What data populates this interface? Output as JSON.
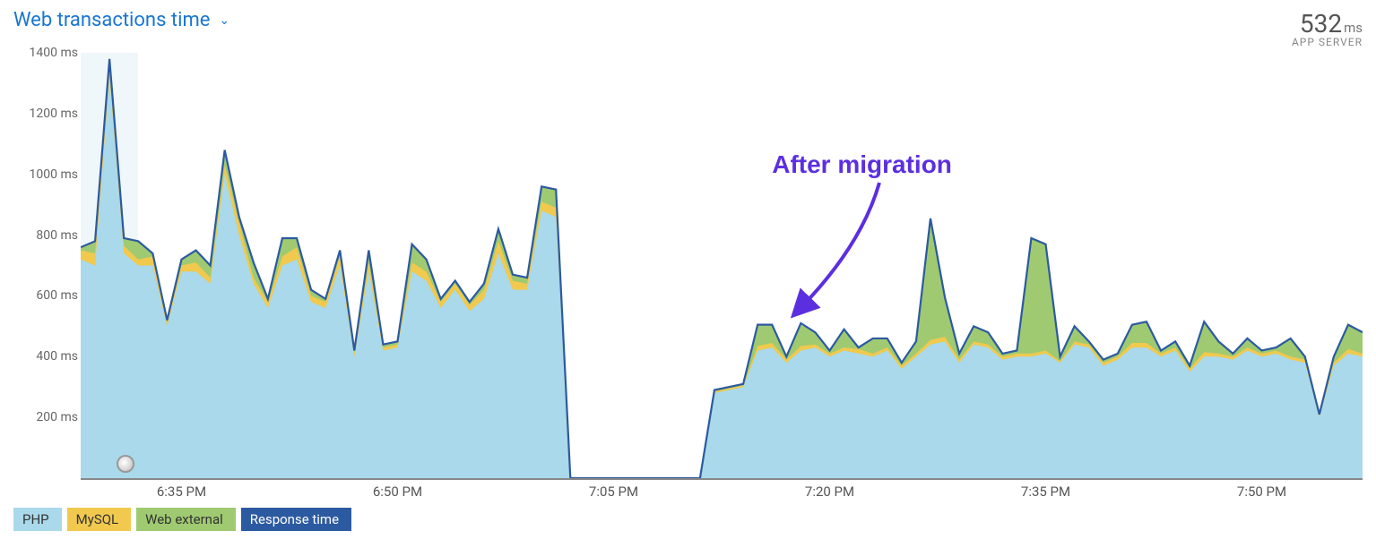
{
  "header": {
    "title": "Web transactions time",
    "metric_value": "532",
    "metric_unit": "ms",
    "metric_label": "APP SERVER"
  },
  "legend": {
    "php": "PHP",
    "mysql": "MySQL",
    "web_external": "Web external",
    "response_time": "Response time"
  },
  "annotation": {
    "label": "After migration"
  },
  "chart_data": {
    "type": "area",
    "title": "Web transactions time",
    "xlabel": "",
    "ylabel": "ms",
    "ylim": [
      0,
      1400
    ],
    "x_ticks": [
      "6:35 PM",
      "6:50 PM",
      "7:05 PM",
      "7:20 PM",
      "7:35 PM",
      "7:50 PM"
    ],
    "y_ticks": [
      200,
      400,
      600,
      800,
      1000,
      1200,
      1400
    ],
    "series": [
      {
        "name": "PHP",
        "color": "#a9d9ea",
        "role": "stack-bottom"
      },
      {
        "name": "MySQL",
        "color": "#f0c94e",
        "role": "stack-mid"
      },
      {
        "name": "Web external",
        "color": "#9fca71",
        "role": "stack-top"
      },
      {
        "name": "Response time",
        "color": "#2c5aa0",
        "role": "line"
      }
    ],
    "x_minutes_start": 388,
    "x_minutes_end": 477,
    "points": [
      {
        "t": 388,
        "php": 720,
        "mysql": 30,
        "web": 10,
        "rt": 760
      },
      {
        "t": 389,
        "php": 700,
        "mysql": 40,
        "web": 40,
        "rt": 780
      },
      {
        "t": 390,
        "php": 1320,
        "mysql": 30,
        "web": 30,
        "rt": 1380
      },
      {
        "t": 391,
        "php": 740,
        "mysql": 25,
        "web": 25,
        "rt": 790
      },
      {
        "t": 392,
        "php": 700,
        "mysql": 20,
        "web": 60,
        "rt": 780
      },
      {
        "t": 393,
        "php": 700,
        "mysql": 30,
        "web": 10,
        "rt": 740
      },
      {
        "t": 394,
        "php": 500,
        "mysql": 10,
        "web": 10,
        "rt": 520
      },
      {
        "t": 395,
        "php": 680,
        "mysql": 20,
        "web": 20,
        "rt": 720
      },
      {
        "t": 396,
        "php": 680,
        "mysql": 30,
        "web": 40,
        "rt": 750
      },
      {
        "t": 397,
        "php": 640,
        "mysql": 20,
        "web": 40,
        "rt": 700
      },
      {
        "t": 398,
        "php": 1000,
        "mysql": 30,
        "web": 50,
        "rt": 1080
      },
      {
        "t": 399,
        "php": 800,
        "mysql": 40,
        "web": 20,
        "rt": 860
      },
      {
        "t": 400,
        "php": 640,
        "mysql": 20,
        "web": 50,
        "rt": 710
      },
      {
        "t": 401,
        "php": 560,
        "mysql": 20,
        "web": 10,
        "rt": 590
      },
      {
        "t": 402,
        "php": 700,
        "mysql": 30,
        "web": 60,
        "rt": 790
      },
      {
        "t": 403,
        "php": 720,
        "mysql": 40,
        "web": 30,
        "rt": 790
      },
      {
        "t": 404,
        "php": 580,
        "mysql": 20,
        "web": 20,
        "rt": 620
      },
      {
        "t": 405,
        "php": 560,
        "mysql": 20,
        "web": 10,
        "rt": 590
      },
      {
        "t": 406,
        "php": 700,
        "mysql": 30,
        "web": 20,
        "rt": 750
      },
      {
        "t": 407,
        "php": 400,
        "mysql": 10,
        "web": 10,
        "rt": 420
      },
      {
        "t": 408,
        "php": 680,
        "mysql": 30,
        "web": 40,
        "rt": 750
      },
      {
        "t": 409,
        "php": 420,
        "mysql": 10,
        "web": 10,
        "rt": 440
      },
      {
        "t": 410,
        "php": 430,
        "mysql": 10,
        "web": 10,
        "rt": 450
      },
      {
        "t": 411,
        "php": 680,
        "mysql": 30,
        "web": 60,
        "rt": 770
      },
      {
        "t": 412,
        "php": 650,
        "mysql": 30,
        "web": 40,
        "rt": 720
      },
      {
        "t": 413,
        "php": 560,
        "mysql": 20,
        "web": 10,
        "rt": 590
      },
      {
        "t": 414,
        "php": 620,
        "mysql": 20,
        "web": 10,
        "rt": 650
      },
      {
        "t": 415,
        "php": 550,
        "mysql": 20,
        "web": 10,
        "rt": 580
      },
      {
        "t": 416,
        "php": 590,
        "mysql": 30,
        "web": 20,
        "rt": 640
      },
      {
        "t": 417,
        "php": 740,
        "mysql": 40,
        "web": 40,
        "rt": 820
      },
      {
        "t": 418,
        "php": 620,
        "mysql": 30,
        "web": 20,
        "rt": 670
      },
      {
        "t": 419,
        "php": 620,
        "mysql": 20,
        "web": 20,
        "rt": 660
      },
      {
        "t": 420,
        "php": 880,
        "mysql": 30,
        "web": 50,
        "rt": 960
      },
      {
        "t": 421,
        "php": 860,
        "mysql": 30,
        "web": 60,
        "rt": 950
      },
      {
        "t": 422,
        "php": 0,
        "mysql": 0,
        "web": 0,
        "rt": 0
      },
      {
        "t": 431,
        "php": 0,
        "mysql": 0,
        "web": 0,
        "rt": 0
      },
      {
        "t": 432,
        "php": 280,
        "mysql": 5,
        "web": 5,
        "rt": 290
      },
      {
        "t": 434,
        "php": 300,
        "mysql": 5,
        "web": 5,
        "rt": 310
      },
      {
        "t": 435,
        "php": 420,
        "mysql": 15,
        "web": 70,
        "rt": 505
      },
      {
        "t": 436,
        "php": 430,
        "mysql": 15,
        "web": 60,
        "rt": 505
      },
      {
        "t": 437,
        "php": 380,
        "mysql": 10,
        "web": 10,
        "rt": 400
      },
      {
        "t": 438,
        "php": 420,
        "mysql": 15,
        "web": 70,
        "rt": 510
      },
      {
        "t": 439,
        "php": 430,
        "mysql": 10,
        "web": 40,
        "rt": 480
      },
      {
        "t": 440,
        "php": 400,
        "mysql": 10,
        "web": 10,
        "rt": 420
      },
      {
        "t": 441,
        "php": 420,
        "mysql": 10,
        "web": 60,
        "rt": 490
      },
      {
        "t": 442,
        "php": 410,
        "mysql": 15,
        "web": 5,
        "rt": 430
      },
      {
        "t": 443,
        "php": 400,
        "mysql": 10,
        "web": 50,
        "rt": 460
      },
      {
        "t": 444,
        "php": 420,
        "mysql": 10,
        "web": 30,
        "rt": 460
      },
      {
        "t": 445,
        "php": 360,
        "mysql": 10,
        "web": 10,
        "rt": 380
      },
      {
        "t": 446,
        "php": 400,
        "mysql": 10,
        "web": 40,
        "rt": 450
      },
      {
        "t": 447,
        "php": 440,
        "mysql": 15,
        "web": 400,
        "rt": 855
      },
      {
        "t": 448,
        "php": 450,
        "mysql": 15,
        "web": 130,
        "rt": 595
      },
      {
        "t": 449,
        "php": 380,
        "mysql": 10,
        "web": 20,
        "rt": 410
      },
      {
        "t": 450,
        "php": 440,
        "mysql": 10,
        "web": 50,
        "rt": 500
      },
      {
        "t": 451,
        "php": 430,
        "mysql": 10,
        "web": 40,
        "rt": 480
      },
      {
        "t": 452,
        "php": 390,
        "mysql": 10,
        "web": 10,
        "rt": 410
      },
      {
        "t": 453,
        "php": 400,
        "mysql": 10,
        "web": 10,
        "rt": 420
      },
      {
        "t": 454,
        "php": 400,
        "mysql": 10,
        "web": 380,
        "rt": 790
      },
      {
        "t": 455,
        "php": 410,
        "mysql": 10,
        "web": 350,
        "rt": 770
      },
      {
        "t": 456,
        "php": 380,
        "mysql": 5,
        "web": 15,
        "rt": 400
      },
      {
        "t": 457,
        "php": 440,
        "mysql": 10,
        "web": 50,
        "rt": 500
      },
      {
        "t": 458,
        "php": 430,
        "mysql": 10,
        "web": 10,
        "rt": 450
      },
      {
        "t": 459,
        "php": 370,
        "mysql": 10,
        "web": 10,
        "rt": 390
      },
      {
        "t": 460,
        "php": 390,
        "mysql": 10,
        "web": 10,
        "rt": 410
      },
      {
        "t": 461,
        "php": 430,
        "mysql": 15,
        "web": 60,
        "rt": 505
      },
      {
        "t": 462,
        "php": 430,
        "mysql": 15,
        "web": 70,
        "rt": 515
      },
      {
        "t": 463,
        "php": 400,
        "mysql": 10,
        "web": 10,
        "rt": 420
      },
      {
        "t": 464,
        "php": 420,
        "mysql": 10,
        "web": 20,
        "rt": 450
      },
      {
        "t": 465,
        "php": 350,
        "mysql": 10,
        "web": 10,
        "rt": 370
      },
      {
        "t": 466,
        "php": 400,
        "mysql": 15,
        "web": 100,
        "rt": 515
      },
      {
        "t": 467,
        "php": 400,
        "mysql": 10,
        "web": 40,
        "rt": 450
      },
      {
        "t": 468,
        "php": 390,
        "mysql": 10,
        "web": 10,
        "rt": 410
      },
      {
        "t": 469,
        "php": 420,
        "mysql": 10,
        "web": 30,
        "rt": 460
      },
      {
        "t": 470,
        "php": 400,
        "mysql": 10,
        "web": 10,
        "rt": 420
      },
      {
        "t": 471,
        "php": 410,
        "mysql": 10,
        "web": 10,
        "rt": 430
      },
      {
        "t": 472,
        "php": 390,
        "mysql": 10,
        "web": 60,
        "rt": 460
      },
      {
        "t": 473,
        "php": 380,
        "mysql": 10,
        "web": 10,
        "rt": 400
      },
      {
        "t": 474,
        "php": 200,
        "mysql": 5,
        "web": 5,
        "rt": 210
      },
      {
        "t": 475,
        "php": 370,
        "mysql": 10,
        "web": 20,
        "rt": 400
      },
      {
        "t": 476,
        "php": 410,
        "mysql": 15,
        "web": 80,
        "rt": 505
      },
      {
        "t": 477,
        "php": 400,
        "mysql": 10,
        "web": 70,
        "rt": 480
      }
    ]
  }
}
